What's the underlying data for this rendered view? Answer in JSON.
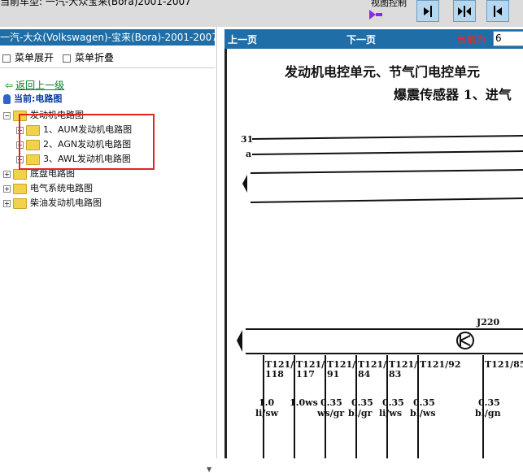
{
  "window": {
    "title": "当前车型: 一汽-大众宝来(Bora)2001-2007",
    "view_control_label": "视图控制"
  },
  "left_panel": {
    "title": "一汽-大众(Volkswagen)-宝来(Bora)-2001-2007",
    "menu_expand": "菜单展开",
    "menu_collapse": "菜单折叠",
    "back_link": "返回上一级",
    "current_label": "当前:电路图",
    "tree": {
      "root": "发动机电路图",
      "children": [
        "1、AUM发动机电路图",
        "2、AGN发动机电路图",
        "3、AWL发动机电路图"
      ],
      "siblings": [
        "底盘电路图",
        "电气系统电路图",
        "柴油发动机电路图"
      ]
    }
  },
  "document": {
    "prev_page": "上一页",
    "next_page": "下一页",
    "current_page_label": "当前为",
    "current_page_value": "6",
    "title_line1": "发动机电控单元、节气门电控单元",
    "title_line2": "爆震传感器 1、进气",
    "labels": {
      "wire_31": "31",
      "wire_a": "a",
      "component": "J220",
      "pins": [
        "T121/118",
        "T121/117",
        "T121/91",
        "T121/84",
        "T121/83",
        "T121/92",
        "T121/85"
      ],
      "pin_short": [
        "T121/",
        "T121/",
        "T121/",
        "T121/",
        "T121/",
        "T121/92",
        "T121/85"
      ],
      "pin_num": [
        "118",
        "117",
        "91",
        "84",
        "83",
        "",
        ""
      ],
      "wire_sizes": [
        "1.0",
        "1.0ws",
        "0.35",
        "0.35",
        "0.35",
        "0.35",
        "0.35"
      ],
      "wire_colors": [
        "li/sw",
        "",
        "ws/gr",
        "bl/gr",
        "li/ws",
        "bl/ws",
        "bl/gn"
      ]
    }
  }
}
